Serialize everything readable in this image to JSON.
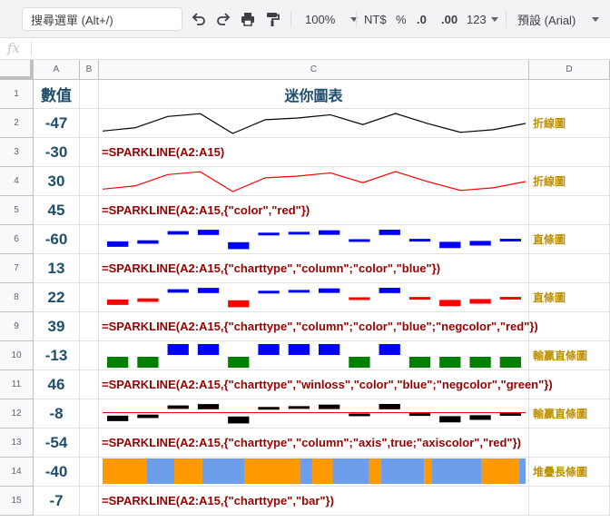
{
  "toolbar": {
    "menu_search_placeholder": "搜尋選單 (Alt+/)",
    "zoom": "100%",
    "currency": "NT$",
    "percent": "%",
    "decimal_decrease": ".0",
    "decimal_increase": ".00",
    "number_format": "123",
    "font": "預設 (Arial)",
    "icons": [
      "undo-icon",
      "redo-icon",
      "print-icon",
      "paint-format-icon"
    ]
  },
  "formula_bar": {
    "fx_label": "fx",
    "value": ""
  },
  "columns": [
    "A",
    "B",
    "C",
    "D"
  ],
  "rows": [
    {
      "num": "1",
      "a": "數值",
      "c": "迷你圖表",
      "d": ""
    },
    {
      "num": "2",
      "a": "-47",
      "c": "",
      "d": "折線圖"
    },
    {
      "num": "3",
      "a": "-30",
      "c": "=SPARKLINE(A2:A15)",
      "d": ""
    },
    {
      "num": "4",
      "a": "30",
      "c": "",
      "d": "折線圖"
    },
    {
      "num": "5",
      "a": "45",
      "c": "=SPARKLINE(A2:A15,{\"color\",\"red\"})",
      "d": ""
    },
    {
      "num": "6",
      "a": "-60",
      "c": "",
      "d": "直條圖"
    },
    {
      "num": "7",
      "a": "13",
      "c": "=SPARKLINE(A2:A15,{\"charttype\",\"column\";\"color\",\"blue\"})",
      "d": ""
    },
    {
      "num": "8",
      "a": "22",
      "c": "",
      "d": "直條圖"
    },
    {
      "num": "9",
      "a": "39",
      "c": "=SPARKLINE(A2:A15,{\"charttype\",\"column\";\"color\",\"blue\";\"negcolor\",\"red\"})",
      "d": ""
    },
    {
      "num": "10",
      "a": "-13",
      "c": "",
      "d": "輸贏直條圖"
    },
    {
      "num": "11",
      "a": "46",
      "c": "=SPARKLINE(A2:A15,{\"charttype\",\"winloss\",\"color\",\"blue\";\"negcolor\",\"green\"})",
      "d": ""
    },
    {
      "num": "12",
      "a": "-8",
      "c": "",
      "d": "輸贏直條圖"
    },
    {
      "num": "13",
      "a": "-54",
      "c": "=SPARKLINE(A2:A15,{\"charttype\",\"column\";\"axis\",true;\"axiscolor\",\"red\"})",
      "d": ""
    },
    {
      "num": "14",
      "a": "-40",
      "c": "",
      "d": "堆疊長條圖"
    },
    {
      "num": "15",
      "a": "-7",
      "c": "=SPARKLINE(A2:A15,{\"charttype\",\"bar\"})",
      "d": ""
    }
  ],
  "sparkline_values": [
    -47,
    -30,
    30,
    45,
    -60,
    13,
    22,
    39,
    -13,
    46,
    -8,
    -54,
    -40,
    -7
  ],
  "sparklines": [
    {
      "row": 2,
      "type": "line",
      "color": "#000000"
    },
    {
      "row": 4,
      "type": "line",
      "color": "#ff0000"
    },
    {
      "row": 6,
      "type": "column",
      "color": "#0000ff"
    },
    {
      "row": 8,
      "type": "column",
      "color": "#0000ff",
      "negcolor": "#ff0000"
    },
    {
      "row": 10,
      "type": "winloss",
      "color": "#0000ff",
      "negcolor": "#008000"
    },
    {
      "row": 12,
      "type": "column",
      "color": "#000000",
      "axis": true,
      "axiscolor": "#ff0000"
    },
    {
      "row": 14,
      "type": "bar",
      "colors": [
        "#ff9900",
        "#6d9eeb"
      ]
    }
  ]
}
